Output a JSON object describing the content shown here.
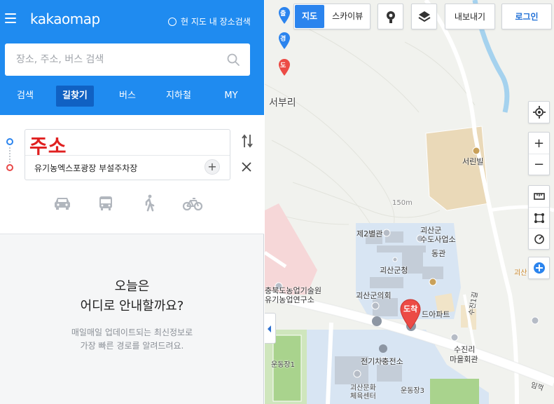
{
  "header": {
    "logo": "kakaomap",
    "region_search_label": "현 지도 내 장소검색"
  },
  "search": {
    "placeholder": "장소, 주소, 버스 검색"
  },
  "tabs": [
    {
      "label": "검색",
      "active": false
    },
    {
      "label": "길찾기",
      "active": true
    },
    {
      "label": "버스",
      "active": false
    },
    {
      "label": "지하철",
      "active": false
    },
    {
      "label": "MY",
      "active": false
    }
  ],
  "route": {
    "start": "주소",
    "end": "유기농엑스포광장 부설주차장",
    "modes": [
      "car-icon",
      "bus-icon",
      "walk-icon",
      "bike-icon"
    ]
  },
  "empty_state": {
    "title_line1": "오늘은",
    "title_line2": "어디로 안내할까요?",
    "sub_line1": "매일매일 업데이트되는 최신정보로",
    "sub_line2": "가장 빠른 경로를 알려드려요."
  },
  "map": {
    "view_tabs": {
      "map": "지도",
      "skyview": "스카이뷰"
    },
    "export_label": "내보내기",
    "login_label": "로그인",
    "pins": {
      "start": "출",
      "via": "경",
      "end": "도"
    },
    "arrival_marker": "도착",
    "labels": {
      "seoburi": "서부리",
      "seorinvil": "서린빌",
      "elevation": "150m",
      "second_annex": "제2별관",
      "water_office_1": "괴산군",
      "water_office_2": "수도사업소",
      "dong": "동관",
      "county_office": "괴산군청",
      "agri_1": "충북도농업기술원",
      "agri_2": "유기농업연구소",
      "council": "괴산군의회",
      "apart": "드아파트",
      "suhwa": "수진1길",
      "sujin_1": "수진리",
      "sujin_2": "마을회관",
      "substation": "전기차충전소",
      "field1": "운동장1",
      "field3": "운동장3",
      "culture_1": "괴산문화",
      "culture_2": "체육센터",
      "imgak": "임꺽",
      "goesan_edge": "괴산"
    },
    "colors": {
      "brand": "#1f8bf0",
      "tab_active": "#1061c3",
      "accent": "#e02020"
    }
  }
}
